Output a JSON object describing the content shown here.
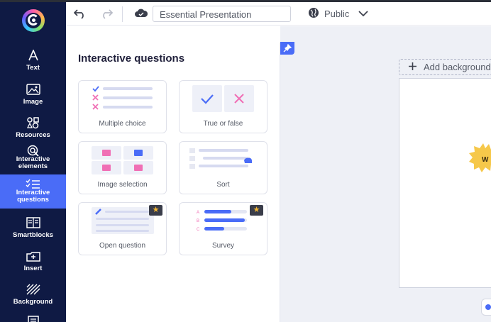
{
  "rail": {
    "items": [
      {
        "label": "Text",
        "icon": "text-icon"
      },
      {
        "label": "Image",
        "icon": "image-icon"
      },
      {
        "label": "Resources",
        "icon": "resources-icon"
      },
      {
        "label_line1": "Interactive",
        "label_line2": "elements",
        "icon": "interactive-elements-icon"
      },
      {
        "label_line1": "Interactive",
        "label_line2": "questions",
        "icon": "interactive-questions-icon",
        "active": true
      },
      {
        "label": "Smartblocks",
        "icon": "smartblocks-icon"
      },
      {
        "label": "Insert",
        "icon": "insert-icon"
      },
      {
        "label": "Background",
        "icon": "background-icon"
      }
    ]
  },
  "topbar": {
    "title": "Essential Presentation",
    "visibility": "Public"
  },
  "panel": {
    "title": "Interactive questions",
    "cards": [
      {
        "label": "Multiple choice",
        "premium": false
      },
      {
        "label": "True or false",
        "premium": false
      },
      {
        "label": "Image selection",
        "premium": false
      },
      {
        "label": "Sort",
        "premium": false
      },
      {
        "label": "Open question",
        "premium": true
      },
      {
        "label": "Survey",
        "premium": true
      }
    ]
  },
  "canvas": {
    "add_background": "Add background",
    "burst_text": "W"
  },
  "colors": {
    "rail_bg": "#0f1a44",
    "accent": "#4a6cf7",
    "pink": "#f06fb5",
    "star": "#f5b731",
    "burst": "#f6c84a"
  }
}
